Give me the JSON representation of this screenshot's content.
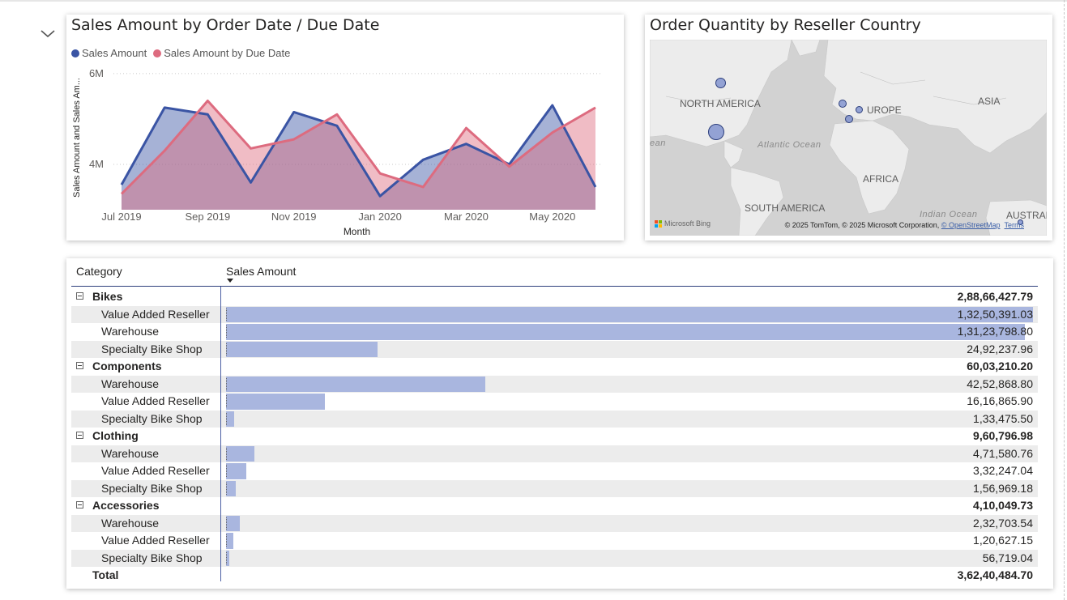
{
  "line_chart": {
    "title": "Sales Amount by Order Date / Due Date",
    "legend": [
      {
        "name": "Sales Amount",
        "color": "#3a54a4"
      },
      {
        "name": "Sales Amount by Due Date",
        "color": "#dd6b7f"
      }
    ],
    "chart_data": {
      "type": "area",
      "title": "Sales Amount by Order Date / Due Date",
      "xlabel": "Month",
      "ylabel": "Sales Amount and Sales Am...",
      "x_tick_labels": [
        "Jul 2019",
        "Sep 2019",
        "Nov 2019",
        "Jan 2020",
        "Mar 2020",
        "May 2020"
      ],
      "y_tick_labels": [
        "6M",
        "4M"
      ],
      "y_ticks": [
        6000000,
        4000000
      ],
      "ylim": [
        3000000,
        6300000
      ],
      "grid": true,
      "legend_position": "top-left",
      "categories": [
        "Jul 2019",
        "Aug 2019",
        "Sep 2019",
        "Oct 2019",
        "Nov 2019",
        "Dec 2019",
        "Jan 2020",
        "Feb 2020",
        "Mar 2020",
        "Apr 2020",
        "May 2020",
        "Jun 2020"
      ],
      "series": [
        {
          "name": "Sales Amount",
          "color": "#3a54a4",
          "values": [
            3550000,
            5250000,
            5100000,
            3600000,
            5150000,
            4850000,
            3300000,
            4100000,
            4450000,
            4000000,
            5300000,
            3500000
          ]
        },
        {
          "name": "Sales Amount by Due Date",
          "color": "#dd6b7f",
          "values": [
            3350000,
            4300000,
            5400000,
            4350000,
            4550000,
            5100000,
            3800000,
            3500000,
            4800000,
            3950000,
            4700000,
            5250000
          ]
        }
      ]
    }
  },
  "map": {
    "title": "Order Quantity by Reseller Country",
    "continent_labels": [
      "NORTH AMERICA",
      "UROPE",
      "ASIA",
      "AFRICA",
      "SOUTH AMERICA",
      "AUSTRAL"
    ],
    "ocean_labels": [
      "Atlantic Ocean",
      "Indian Ocean",
      "ean"
    ],
    "provider": "Microsoft Bing",
    "copyright_text": "© 2025 TomTom, © 2025 Microsoft Corporation,",
    "osm_link": "© OpenStreetMap",
    "terms_link": "Terms"
  },
  "matrix": {
    "headers": {
      "category": "Category",
      "sales": "Sales Amount"
    },
    "max_value": 13250391.03,
    "rows": [
      {
        "kind": "cat",
        "label": "Bikes",
        "value": "2,88,66,427.79"
      },
      {
        "kind": "sub",
        "label": "Value Added Reseller",
        "value": "1,32,50,391.03",
        "amount": 13250391.03,
        "shade": true
      },
      {
        "kind": "sub",
        "label": "Warehouse",
        "value": "1,31,23,798.80",
        "amount": 13123798.8,
        "shade": false
      },
      {
        "kind": "sub",
        "label": "Specialty Bike Shop",
        "value": "24,92,237.96",
        "amount": 2492237.96,
        "shade": true
      },
      {
        "kind": "cat",
        "label": "Components",
        "value": "60,03,210.20"
      },
      {
        "kind": "sub",
        "label": "Warehouse",
        "value": "42,52,868.80",
        "amount": 4252868.8,
        "shade": true
      },
      {
        "kind": "sub",
        "label": "Value Added Reseller",
        "value": "16,16,865.90",
        "amount": 1616865.9,
        "shade": false
      },
      {
        "kind": "sub",
        "label": "Specialty Bike Shop",
        "value": "1,33,475.50",
        "amount": 133475.5,
        "shade": true
      },
      {
        "kind": "cat",
        "label": "Clothing",
        "value": "9,60,796.98"
      },
      {
        "kind": "sub",
        "label": "Warehouse",
        "value": "4,71,580.76",
        "amount": 471580.76,
        "shade": true
      },
      {
        "kind": "sub",
        "label": "Value Added Reseller",
        "value": "3,32,247.04",
        "amount": 332247.04,
        "shade": false
      },
      {
        "kind": "sub",
        "label": "Specialty Bike Shop",
        "value": "1,56,969.18",
        "amount": 156969.18,
        "shade": true
      },
      {
        "kind": "cat",
        "label": "Accessories",
        "value": "4,10,049.73"
      },
      {
        "kind": "sub",
        "label": "Warehouse",
        "value": "2,32,703.54",
        "amount": 232703.54,
        "shade": true
      },
      {
        "kind": "sub",
        "label": "Value Added Reseller",
        "value": "1,20,627.15",
        "amount": 120627.15,
        "shade": false
      },
      {
        "kind": "sub",
        "label": "Specialty Bike Shop",
        "value": "56,719.04",
        "amount": 56719.04,
        "shade": true
      },
      {
        "kind": "total",
        "label": "Total",
        "value": "3,62,40,484.70"
      }
    ]
  }
}
